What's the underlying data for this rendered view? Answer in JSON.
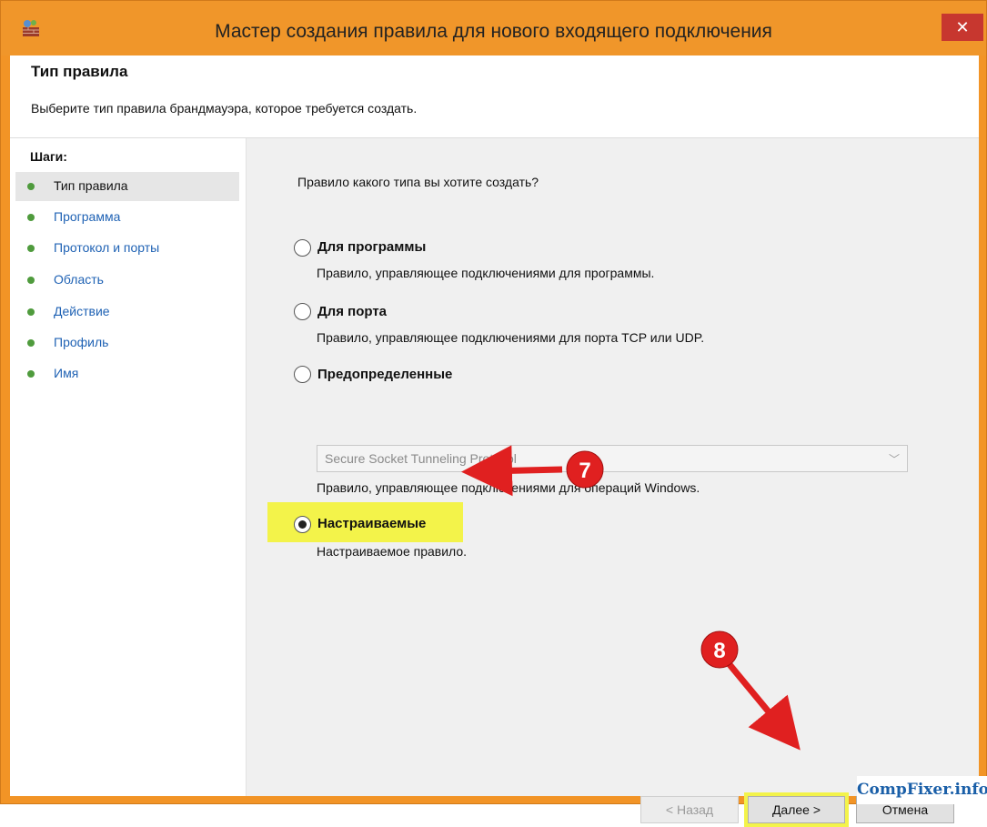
{
  "window": {
    "title": "Мастер создания правила для нового входящего подключения",
    "close_glyph": "✕"
  },
  "header": {
    "title": "Тип правила",
    "description": "Выберите тип правила брандмауэра, которое требуется создать."
  },
  "sidebar": {
    "steps_label": "Шаги:",
    "steps": [
      {
        "label": "Тип правила",
        "active": true
      },
      {
        "label": "Программа",
        "active": false
      },
      {
        "label": "Протокол и порты",
        "active": false
      },
      {
        "label": "Область",
        "active": false
      },
      {
        "label": "Действие",
        "active": false
      },
      {
        "label": "Профиль",
        "active": false
      },
      {
        "label": "Имя",
        "active": false
      }
    ]
  },
  "content": {
    "question": "Правило какого типа вы хотите создать?",
    "options": [
      {
        "label": "Для программы",
        "description": "Правило, управляющее подключениями для программы.",
        "selected": false
      },
      {
        "label": "Для порта",
        "description": "Правило, управляющее подключениями для порта TCP или UDP.",
        "selected": false
      },
      {
        "label": "Предопределенные",
        "description": "Правило, управляющее подключениями для операций Windows.",
        "selected": false,
        "dropdown_value": "Secure Socket Tunneling Protocol"
      },
      {
        "label": "Настраиваемые",
        "description": "Настраиваемое правило.",
        "selected": true
      }
    ]
  },
  "buttons": {
    "back": "< Назад",
    "next": "Далее >",
    "cancel": "Отмена"
  },
  "annotations": {
    "badge_7": "7",
    "badge_8": "8"
  },
  "watermark": {
    "text": "CompFixer.info"
  },
  "colors": {
    "title_bar": "#f0962a",
    "close_button": "#c7372f",
    "highlight": "#f3f34a",
    "annotation_red": "#e02020",
    "step_link": "#1f62b4",
    "step_dot": "#4f9b3d"
  },
  "icons": {
    "app": "firewall-icon",
    "dropdown": "chevron-down-icon"
  }
}
